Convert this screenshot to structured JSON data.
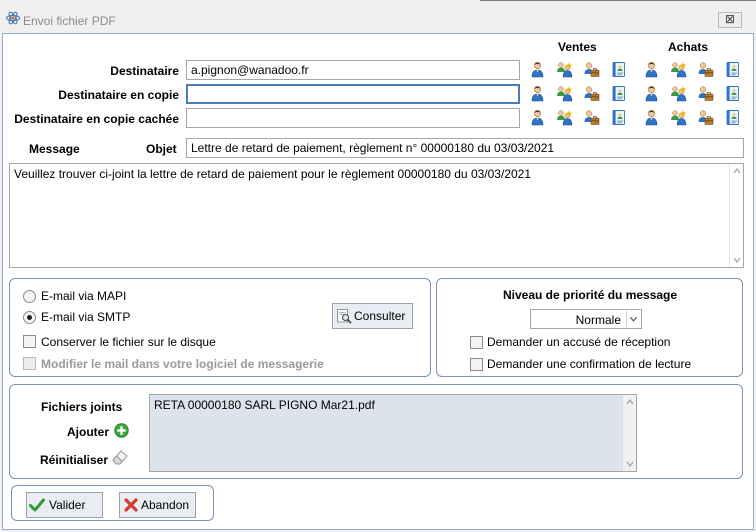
{
  "window": {
    "title": "Envoi fichier PDF",
    "close_glyph": "⊠"
  },
  "columns": {
    "sales": "Ventes",
    "purchases": "Achats"
  },
  "recipients": {
    "to_label": "Destinataire",
    "to_value": "a.pignon@wanadoo.fr",
    "cc_label": "Destinataire en copie",
    "cc_value": "",
    "bcc_label": "Destinataire en copie cachée",
    "bcc_value": ""
  },
  "icon_names": [
    "contact-icon",
    "contacts-group-icon",
    "company-contacts-icon",
    "address-book-icon"
  ],
  "message": {
    "label": "Message",
    "subject_label": "Objet",
    "subject_value": "Lettre de retard de paiement, règlement n° 00000180 du 03/03/2021",
    "body": "Veuillez trouver ci-joint la lettre de retard de paiement pour le règlement 00000180 du 03/03/2021"
  },
  "send_options": {
    "mapi": "E-mail via MAPI",
    "smtp": "E-mail via SMTP",
    "selected": "smtp",
    "keep_file": "Conserver le fichier sur le disque",
    "edit_mail": "Modifier le mail dans votre logiciel de messagerie",
    "consult_label": "Consulter"
  },
  "priority": {
    "title": "Niveau de priorité du message",
    "value": "Normale",
    "receipt": "Demander un accusé de réception",
    "read_confirm": "Demander une confirmation de lecture"
  },
  "attachments": {
    "label": "Fichiers joints",
    "add_label": "Ajouter",
    "reset_label": "Réinitialiser",
    "files": [
      "RETA 00000180 SARL PIGNO Mar21.pdf"
    ]
  },
  "actions": {
    "validate": "Valider",
    "cancel": "Abandon"
  },
  "colors": {
    "accent": "#4a7db8",
    "group_border": "#7a92b8",
    "add_green": "#3aa83a",
    "cancel_red": "#d63a2c"
  }
}
